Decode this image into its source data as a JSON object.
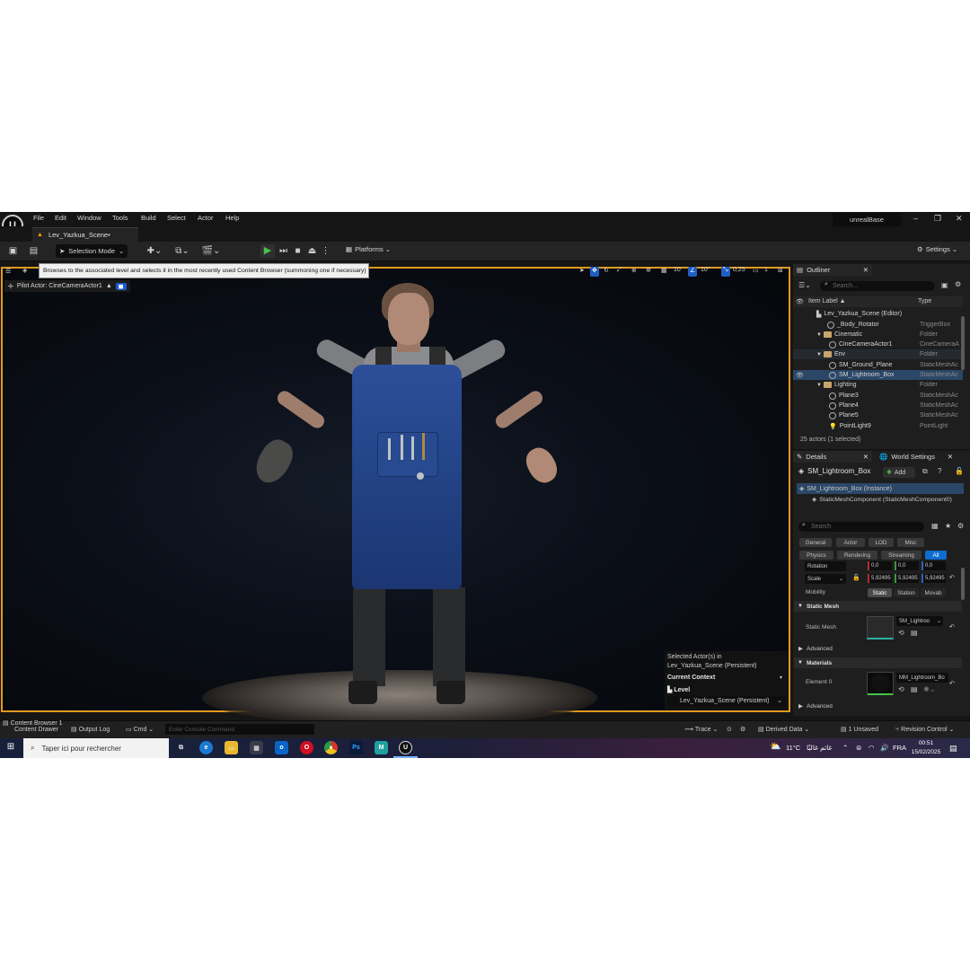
{
  "menu": {
    "items": [
      "File",
      "Edit",
      "Window",
      "Tools",
      "Build",
      "Select",
      "Actor",
      "Help"
    ],
    "project": "unrealBase"
  },
  "tab": {
    "level": "Lev_Yazkua_Scene•"
  },
  "toolbar": {
    "selection_mode": "Selection Mode",
    "platforms": "Platforms",
    "settings": "Settings"
  },
  "viewport": {
    "tooltip": "Browses to the associated level and selects it in the most recently used Content Browser (summoning one if necessary)",
    "pilot": "Pilot Actor: CineCameraActor1",
    "grid": "10",
    "rot": "10°",
    "scale": "0,25",
    "cams": "1",
    "selected_header": "Selected Actor(s) in",
    "selected_level": "Lev_Yazkua_Scene (Persistent)",
    "current_context": "Current Context",
    "level_label": "Level",
    "level_value": "Lev_Yazkua_Scene (Persistent)"
  },
  "outliner": {
    "title": "Outliner",
    "search_placeholder": "Search...",
    "col_label": "Item Label ▲",
    "col_type": "Type",
    "rows": [
      {
        "label": "Lev_Yazkua_Scene (Editor)",
        "type": ""
      },
      {
        "label": "_Body_Rotator",
        "type": "TriggerBox"
      },
      {
        "label": "Cinematic",
        "type": "Folder"
      },
      {
        "label": "CineCameraActor1",
        "type": "CineCameraA"
      },
      {
        "label": "Env",
        "type": "Folder"
      },
      {
        "label": "SM_Ground_Plane",
        "type": "StaticMeshAc"
      },
      {
        "label": "SM_Lightroom_Box",
        "type": "StaticMeshAc"
      },
      {
        "label": "Lighting",
        "type": "Folder"
      },
      {
        "label": "Plane3",
        "type": "StaticMeshAc"
      },
      {
        "label": "Plane4",
        "type": "StaticMeshAc"
      },
      {
        "label": "Plane5",
        "type": "StaticMeshAc"
      },
      {
        "label": "PointLight9",
        "type": "PointLight"
      }
    ],
    "count": "25 actors (1 selected)"
  },
  "details": {
    "tab_details": "Details",
    "tab_world": "World Settings",
    "actor_name": "SM_Lightroom_Box",
    "add_label": "Add",
    "instance": "SM_Lightroom_Box (Instance)",
    "component": "StaticMeshComponent (StaticMeshComponent0)",
    "search_placeholder": "Search",
    "categories_row1": [
      "General",
      "Actor",
      "LOD",
      "Misc"
    ],
    "categories_row2": [
      "Physics",
      "Rendering",
      "Streaming",
      "All"
    ],
    "rotation_label": "Rotation",
    "rotation_values": [
      "0,0",
      "0,0",
      "0,0"
    ],
    "scale_label": "Scale",
    "scale_values": [
      "5,92495",
      "5,92495",
      "5,92495"
    ],
    "mobility_label": "Mobility",
    "mobility_options": [
      "Static",
      "Station",
      "Movab"
    ],
    "section_static_mesh": "Static Mesh",
    "static_mesh_label": "Static Mesh",
    "static_mesh_value": "SM_Lightroo",
    "advanced1": "Advanced",
    "section_materials": "Materials",
    "element0_label": "Element 0",
    "element0_value": "MM_Lightroom_Bo",
    "advanced2": "Advanced"
  },
  "statusbar": {
    "content_drawer": "Content Drawer",
    "content_browser": "Content Browser 1",
    "output_log": "Output Log",
    "cmd": "Cmd",
    "console_placeholder": "Enter Console Command",
    "trace": "Trace",
    "derived": "Derived Data",
    "unsaved": "1 Unsaved",
    "revision": "Revision Control"
  },
  "taskbar": {
    "search": "Taper ici pour rechercher",
    "weather_temp": "11°C",
    "weather_text": "غائم غالبًا",
    "lang": "FRA",
    "time": "00:51",
    "date": "15/02/2025"
  },
  "colors": {
    "selection_border": "#e09a1e",
    "accent_blue": "#0f6cd0",
    "play_green": "#4ac24a"
  }
}
